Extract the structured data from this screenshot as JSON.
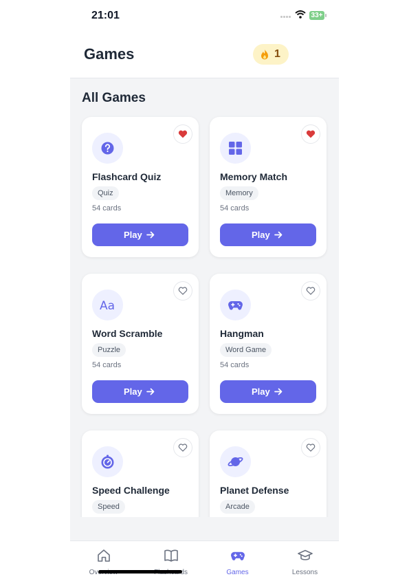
{
  "status_bar": {
    "time": "21:01",
    "battery": "33+"
  },
  "header": {
    "title": "Games",
    "streak_count": "1"
  },
  "section_title": "All Games",
  "games": [
    {
      "name": "Flashcard Quiz",
      "tag": "Quiz",
      "cards": "54 cards",
      "play": "Play",
      "favorited": true,
      "icon": "question-icon"
    },
    {
      "name": "Memory Match",
      "tag": "Memory",
      "cards": "54 cards",
      "play": "Play",
      "favorited": true,
      "icon": "grid-icon"
    },
    {
      "name": "Word Scramble",
      "tag": "Puzzle",
      "cards": "54 cards",
      "play": "Play",
      "favorited": false,
      "icon": "letters-icon"
    },
    {
      "name": "Hangman",
      "tag": "Word Game",
      "cards": "54 cards",
      "play": "Play",
      "favorited": false,
      "icon": "gamepad-icon"
    },
    {
      "name": "Speed Challenge",
      "tag": "Speed",
      "favorited": false,
      "icon": "stopwatch-icon"
    },
    {
      "name": "Planet Defense",
      "tag": "Arcade",
      "favorited": false,
      "icon": "planet-icon"
    }
  ],
  "tab_bar": [
    {
      "label": "Overview",
      "icon": "home-icon",
      "active": false
    },
    {
      "label": "Flashcards",
      "icon": "book-icon",
      "active": false
    },
    {
      "label": "Games",
      "icon": "gamepad-icon",
      "active": true
    },
    {
      "label": "Lessons",
      "icon": "graduation-cap-icon",
      "active": false
    }
  ],
  "colors": {
    "accent": "#6366e8",
    "favorite": "#d93b3b",
    "streak_bg": "#fdf3c7",
    "background": "#f3f4f6"
  }
}
